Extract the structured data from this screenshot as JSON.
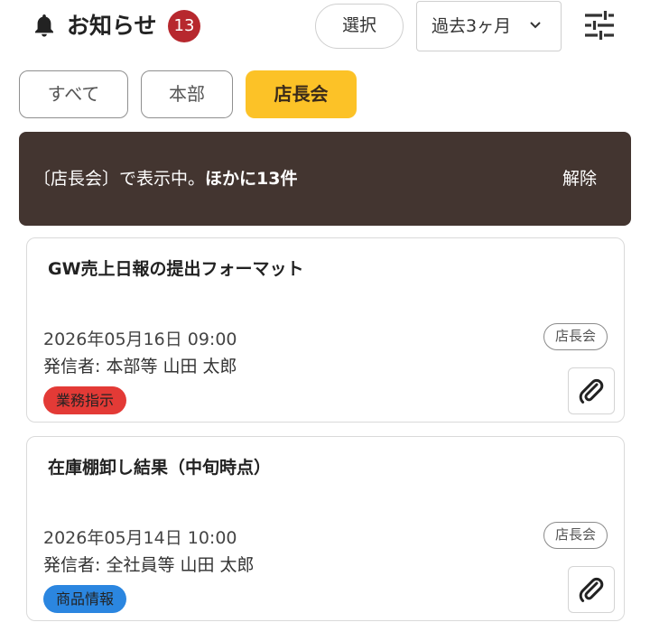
{
  "header": {
    "title": "お知らせ",
    "badge_count": "13",
    "select_label": "選択",
    "period_label": "過去3ヶ月",
    "icons": {
      "bell": "bell-icon",
      "chevron": "chevron-down-icon",
      "filter": "filter-sliders-icon"
    }
  },
  "tabs": [
    {
      "label": "すべて",
      "active": false
    },
    {
      "label": "本部",
      "active": false
    },
    {
      "label": "店長会",
      "active": true
    }
  ],
  "banner": {
    "text": "〔店長会〕で表示中。",
    "bold_text": "ほかに13件",
    "action": "解除"
  },
  "cards": [
    {
      "title": "GW売上日報の提出フォーマット",
      "datetime": "2026年05月16日 09:00",
      "sender": "発信者: 本部等 山田 太郎",
      "category": "業務指示",
      "category_color": "#e33a36",
      "tag": "店長会",
      "icon": "paperclip-icon"
    },
    {
      "title": "在庫棚卸し結果（中旬時点）",
      "datetime": "2026年05月14日 10:00",
      "sender": "発信者: 全社員等 山田 太郎",
      "category": "商品情報",
      "category_color": "#2b86e0",
      "tag": "店長会",
      "icon": "paperclip-icon"
    }
  ],
  "colors": {
    "accent": "#fcc227",
    "badge": "#b7282e",
    "banner_bg": "#433530"
  }
}
